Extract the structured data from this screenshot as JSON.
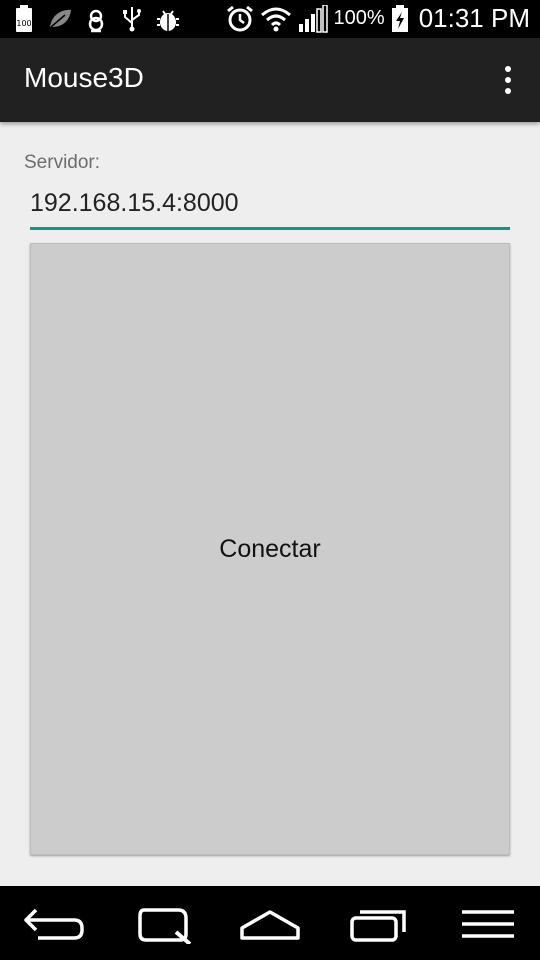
{
  "status_bar": {
    "icons_left": [
      "battery-100-icon",
      "leaf-icon",
      "recycle-icon",
      "usb-icon",
      "debug-bug-icon"
    ],
    "icons_right": [
      "alarm-icon",
      "wifi-icon",
      "signal-icon",
      "charging-icon"
    ],
    "battery_percent": "100%",
    "time": "01:31 PM"
  },
  "action_bar": {
    "title": "Mouse3D",
    "overflow_icon": "more-vertical-icon"
  },
  "form": {
    "server_label": "Servidor:",
    "server_value": "192.168.15.4:8000",
    "connect_label": "Conectar"
  },
  "nav_bar": {
    "buttons": [
      "back-icon",
      "search-icon",
      "home-icon",
      "recents-icon",
      "menu-icon"
    ]
  },
  "colors": {
    "accent": "#139488",
    "action_bar": "#212121",
    "background": "#eeeeee",
    "button": "#cccccc"
  }
}
